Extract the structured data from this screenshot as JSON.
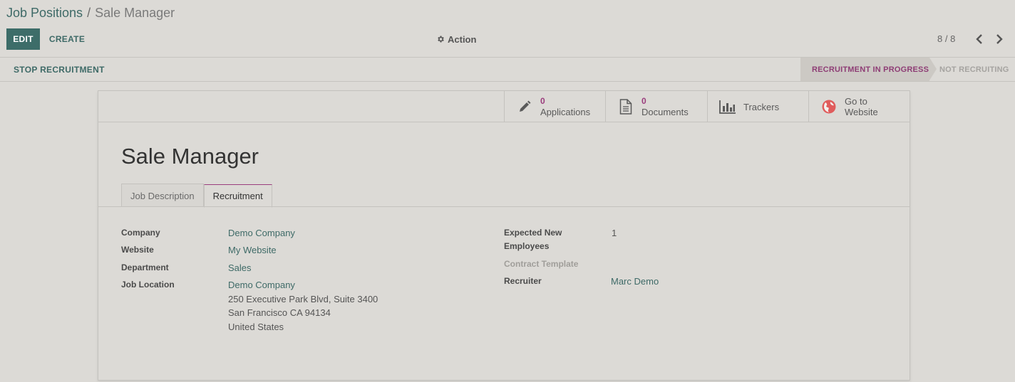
{
  "breadcrumb": {
    "parent": "Job Positions",
    "separator": "/",
    "current": "Sale Manager"
  },
  "toolbar": {
    "edit_label": "EDIT",
    "create_label": "CREATE",
    "action_label": "Action"
  },
  "pager": {
    "value": "8 / 8"
  },
  "statusbar": {
    "stop_label": "STOP RECRUITMENT",
    "stages": [
      {
        "label": "RECRUITMENT IN PROGRESS",
        "active": true
      },
      {
        "label": "NOT RECRUITING",
        "active": false
      }
    ]
  },
  "stat_buttons": {
    "applications": {
      "value": "0",
      "label": "Applications"
    },
    "documents": {
      "value": "0",
      "label": "Documents"
    },
    "trackers": {
      "label": "Trackers"
    },
    "website": {
      "line1": "Go to",
      "line2": "Website"
    }
  },
  "record": {
    "title": "Sale Manager"
  },
  "tabs": [
    {
      "label": "Job Description",
      "active": false
    },
    {
      "label": "Recruitment",
      "active": true
    }
  ],
  "fields_left": {
    "company": {
      "label": "Company",
      "value": "Demo Company"
    },
    "website": {
      "label": "Website",
      "value": "My Website"
    },
    "department": {
      "label": "Department",
      "value": "Sales"
    },
    "job_location": {
      "label": "Job Location",
      "name": "Demo Company",
      "street": "250 Executive Park Blvd, Suite 3400",
      "city": "San Francisco CA 94134",
      "country": "United States"
    }
  },
  "fields_right": {
    "expected": {
      "label_line1": "Expected New",
      "label_line2": "Employees",
      "value": "1"
    },
    "contract_template": {
      "label": "Contract Template"
    },
    "recruiter": {
      "label": "Recruiter",
      "value": "Marc Demo"
    }
  },
  "colors": {
    "primary": "#3d6d69",
    "accent": "#9b3d7d",
    "background": "#dcdad6"
  },
  "icons": {
    "action": "gear-icon",
    "pager_prev": "chevron-left-icon",
    "pager_next": "chevron-right-icon",
    "applications": "pencil-icon",
    "documents": "document-icon",
    "trackers": "bar-chart-icon",
    "website": "globe-icon"
  }
}
